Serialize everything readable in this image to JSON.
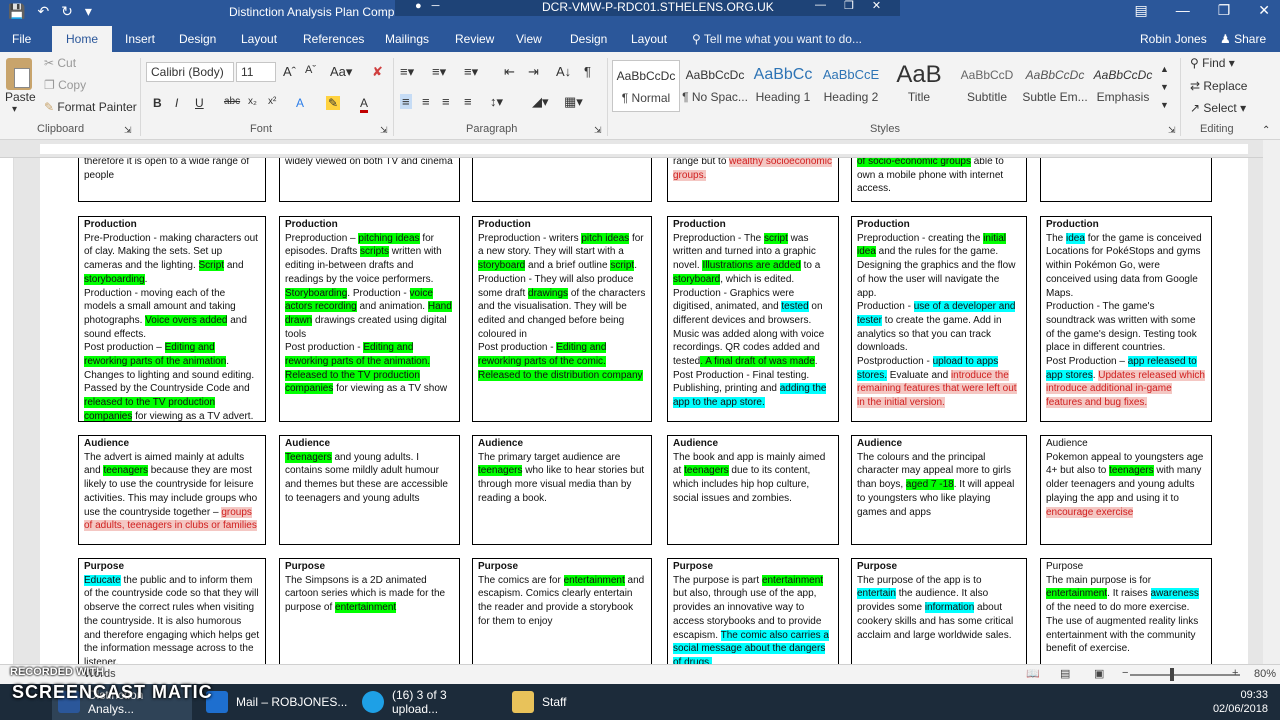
{
  "titlebar": {
    "doc_title": "Distinction Analysis Plan Comp",
    "remote_title": "DCR-VMW-P-RDC01.STHELENS.ORG.UK"
  },
  "tabs": [
    "File",
    "Home",
    "Insert",
    "Design",
    "Layout",
    "References",
    "Mailings",
    "Review",
    "View",
    "Design",
    "Layout"
  ],
  "tell_me": "Tell me what you want to do...",
  "user": "Robin Jones",
  "share": "Share",
  "clipboard": {
    "paste": "Paste",
    "cut": "Cut",
    "copy": "Copy",
    "format_painter": "Format Painter",
    "label": "Clipboard"
  },
  "font": {
    "name": "Calibri (Body)",
    "size": "11",
    "label": "Font"
  },
  "paragraph": {
    "label": "Paragraph"
  },
  "styles": {
    "label": "Styles",
    "items": [
      {
        "sample": "AaBbCcDc",
        "name": "¶ Normal"
      },
      {
        "sample": "AaBbCcDc",
        "name": "¶ No Spac..."
      },
      {
        "sample": "AaBbCc",
        "name": "Heading 1"
      },
      {
        "sample": "AaBbCcE",
        "name": "Heading 2"
      },
      {
        "sample": "AaB",
        "name": "Title"
      },
      {
        "sample": "AaBbCcD",
        "name": "Subtitle"
      },
      {
        "sample": "AaBbCcDc",
        "name": "Subtle Em..."
      },
      {
        "sample": "AaBbCcDc",
        "name": "Emphasis"
      }
    ]
  },
  "editing": {
    "find": "Find",
    "replace": "Replace",
    "select": "Select",
    "label": "Editing"
  },
  "status": {
    "words": "Words",
    "zoom": "80%"
  },
  "taskbar": {
    "items": [
      "Distinction Analys...",
      "Mail – ROBJONES...",
      "(16) 3 of 3 upload...",
      "Staff"
    ],
    "time": "09:33",
    "date": "02/06/2018"
  },
  "watermark": {
    "line1": "RECORDED WITH",
    "line2": "SCREENCAST MATIC"
  },
  "colors": {
    "word_blue": "#2b579a",
    "highlight_green": "#00ff00",
    "highlight_cyan": "#00ffff",
    "highlight_red": "#f4c7c3"
  }
}
